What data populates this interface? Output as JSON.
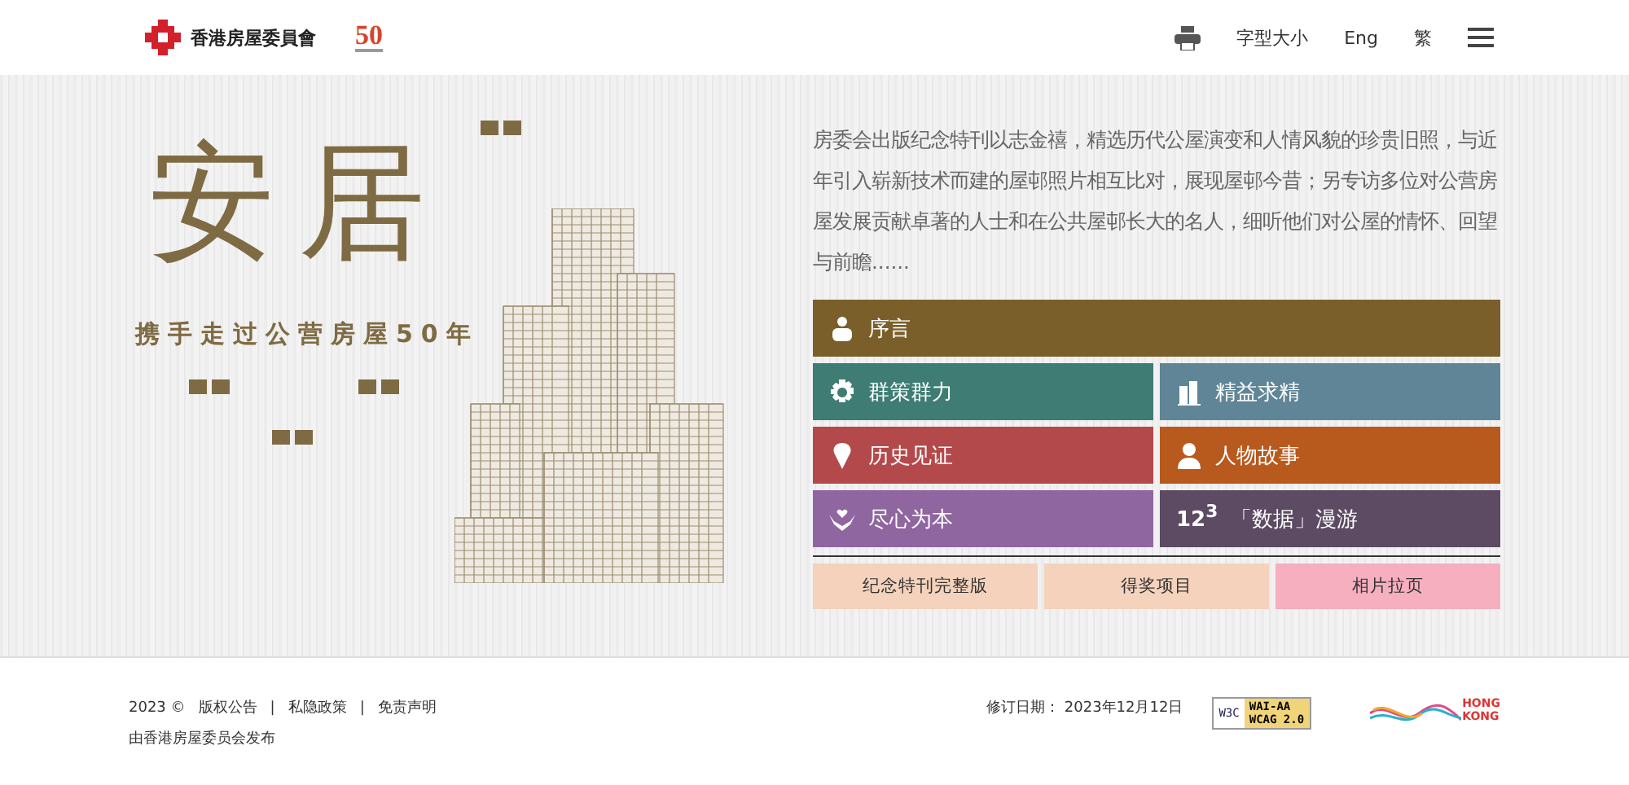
{
  "header": {
    "org_name": "香港房屋委員會",
    "anniversary_logo": "50",
    "font_size": "字型大小",
    "language": "Eng",
    "script": "繁"
  },
  "hero": {
    "title": "安居",
    "subtitle": "携手走过公营房屋50年",
    "intro": "房委会出版纪念特刊以志金禧，精选历代公屋演变和人情风貌的珍贵旧照，与近年引入崭新技术而建的屋邨照片相互比对，展现屋邨今昔；另专访多位对公营房屋发展贡献卓著的人士和在公共屋邨长大的名人，细听他们对公屋的情怀、回望与前瞻......",
    "sections": [
      {
        "label": "序言",
        "kind": "preface",
        "color": "#7b5f2a",
        "wide": true
      },
      {
        "label": "群策群力",
        "kind": "teamwork",
        "color": "#3e7c74",
        "wide": false
      },
      {
        "label": "精益求精",
        "kind": "excellence",
        "color": "#5f8597",
        "wide": false
      },
      {
        "label": "历史见证",
        "kind": "history",
        "color": "#b4494b",
        "wide": false
      },
      {
        "label": "人物故事",
        "kind": "people",
        "color": "#b8591e",
        "wide": false
      },
      {
        "label": "尽心为本",
        "kind": "care",
        "color": "#8f66a0",
        "wide": false
      },
      {
        "label": "「数据」漫游",
        "kind": "data",
        "badge": "12$^{3}$",
        "color": "#5c4b63",
        "wide": false
      }
    ],
    "links": [
      {
        "label": "纪念特刊完整版",
        "color": "#f4d2bc"
      },
      {
        "label": "得奖项目",
        "color": "#f4d2bc"
      },
      {
        "label": "相片拉页",
        "color": "#f5afbf"
      }
    ]
  },
  "footer": {
    "copyright": "2023 ©",
    "links": [
      "版权公告",
      "私隐政策",
      "免责声明"
    ],
    "separator": "|",
    "publisher": "由香港房屋委员会发布",
    "revised": "修订日期： 2023年12月12日",
    "w3c_badge": {
      "w3c": "W3C",
      "level": "WAI-AA",
      "standard": "WCAG 2.0"
    },
    "brand_logo": {
      "line_1": "HONG",
      "line_2": "KONG"
    }
  }
}
